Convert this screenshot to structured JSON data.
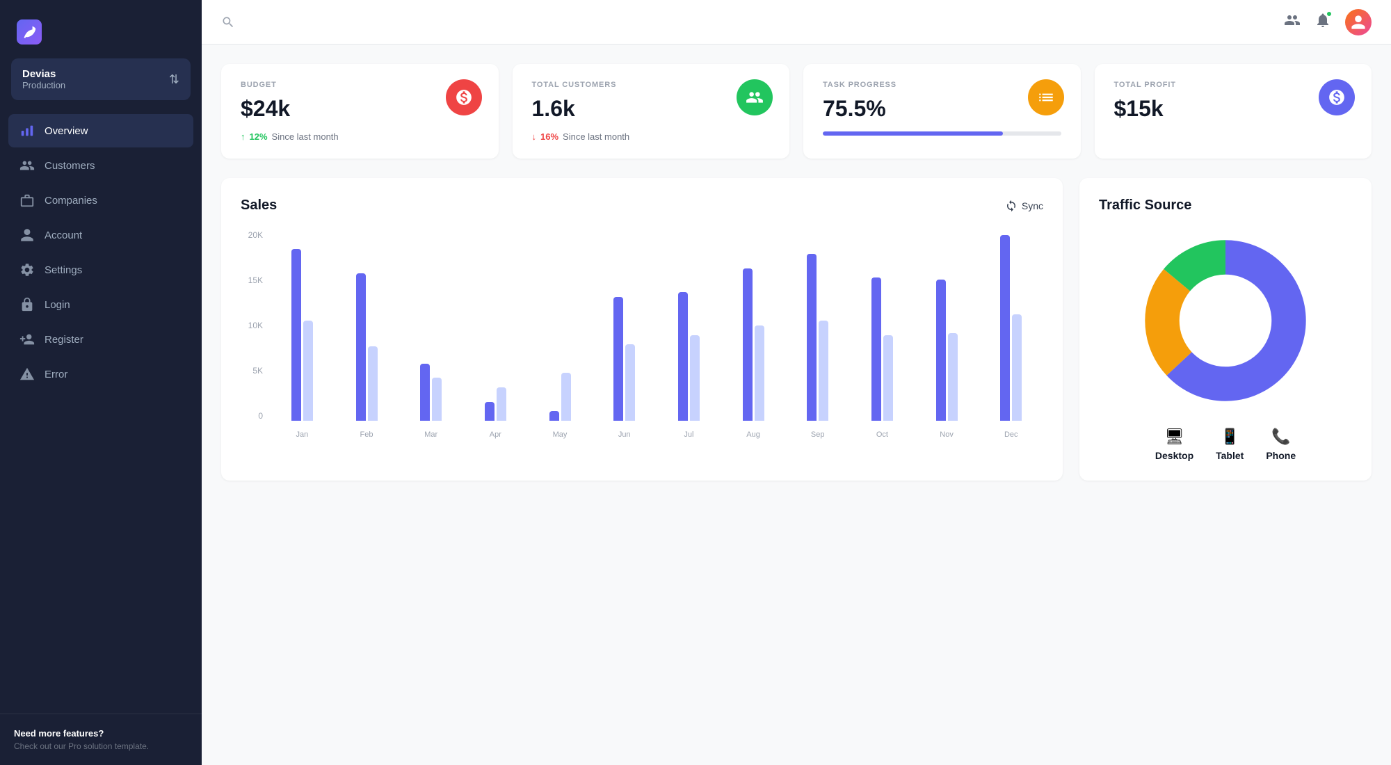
{
  "sidebar": {
    "brand": "Devias",
    "workspace": {
      "name": "Devias",
      "env": "Production"
    },
    "nav": [
      {
        "id": "overview",
        "label": "Overview",
        "icon": "chart-icon",
        "active": true
      },
      {
        "id": "customers",
        "label": "Customers",
        "icon": "users-icon",
        "active": false
      },
      {
        "id": "companies",
        "label": "Companies",
        "icon": "bag-icon",
        "active": false
      },
      {
        "id": "account",
        "label": "Account",
        "icon": "user-icon",
        "active": false
      },
      {
        "id": "settings",
        "label": "Settings",
        "icon": "gear-icon",
        "active": false
      },
      {
        "id": "login",
        "label": "Login",
        "icon": "lock-icon",
        "active": false
      },
      {
        "id": "register",
        "label": "Register",
        "icon": "adduser-icon",
        "active": false
      },
      {
        "id": "error",
        "label": "Error",
        "icon": "warning-icon",
        "active": false
      }
    ],
    "footer": {
      "title": "Need more features?",
      "text": "Check out our Pro solution template."
    }
  },
  "topbar": {
    "search_placeholder": "Search"
  },
  "stats": [
    {
      "id": "budget",
      "label": "BUDGET",
      "value": "$24k",
      "icon_color": "#ef4444",
      "change_type": "up",
      "change_value": "12%",
      "change_label": "Since last month"
    },
    {
      "id": "total_customers",
      "label": "TOTAL CUSTOMERS",
      "value": "1.6k",
      "icon_color": "#22c55e",
      "change_type": "down",
      "change_value": "16%",
      "change_label": "Since last month"
    },
    {
      "id": "task_progress",
      "label": "TASK PROGRESS",
      "value": "75.5%",
      "icon_color": "#f59e0b",
      "progress": 75.5
    },
    {
      "id": "total_profit",
      "label": "TOTAL PROFIT",
      "value": "$15k",
      "icon_color": "#6366f1"
    }
  ],
  "sales_chart": {
    "title": "Sales",
    "sync_label": "Sync",
    "y_labels": [
      "20K",
      "15K",
      "10K",
      "5K",
      "0"
    ],
    "months": [
      "Jan",
      "Feb",
      "Mar",
      "Apr",
      "May",
      "Jun",
      "Jul",
      "Aug",
      "Sep",
      "Oct",
      "Nov",
      "Dec"
    ],
    "primary_bars": [
      180,
      155,
      60,
      20,
      10,
      130,
      135,
      160,
      175,
      150,
      148,
      195
    ],
    "secondary_bars": [
      105,
      78,
      45,
      35,
      50,
      80,
      90,
      100,
      105,
      90,
      92,
      112
    ]
  },
  "traffic_source": {
    "title": "Traffic Source",
    "segments": [
      {
        "label": "Desktop",
        "color": "#6366f1",
        "value": 63,
        "icon": "desktop-icon"
      },
      {
        "label": "Tablet",
        "color": "#f59e0b",
        "value": 23,
        "icon": "tablet-icon"
      },
      {
        "label": "Phone",
        "color": "#22c55e",
        "value": 14,
        "icon": "phone-icon"
      }
    ]
  },
  "colors": {
    "sidebar_bg": "#1a2035",
    "active_nav_bg": "#263050",
    "accent": "#6366f1"
  }
}
